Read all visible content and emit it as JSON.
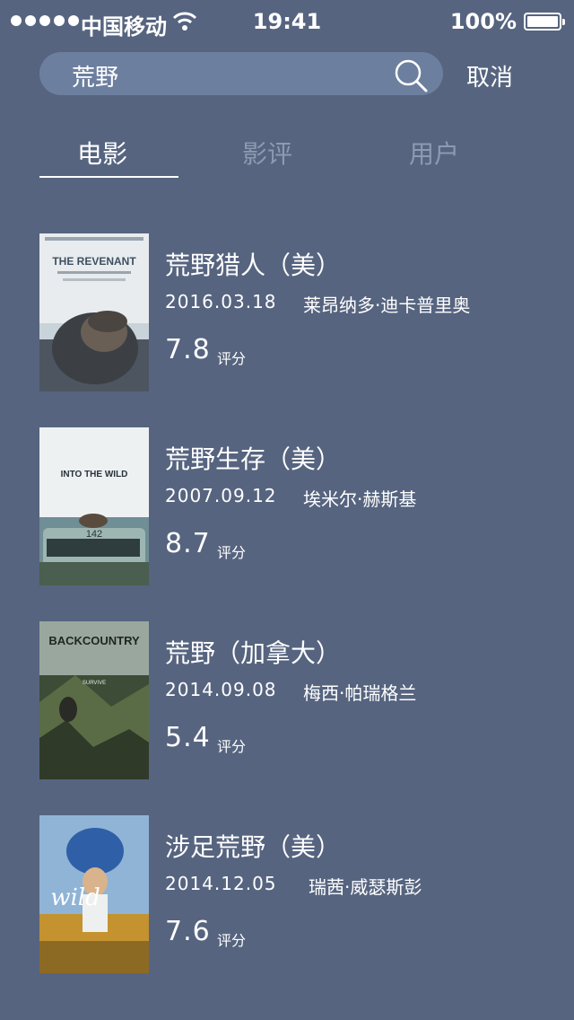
{
  "status_bar": {
    "carrier": "中国移动",
    "time": "19:41",
    "battery": "100%"
  },
  "search": {
    "query": "荒野",
    "cancel_label": "取消"
  },
  "tabs": [
    {
      "label": "电影",
      "active": true
    },
    {
      "label": "影评",
      "active": false
    },
    {
      "label": "用户",
      "active": false
    }
  ],
  "movies": [
    {
      "title": "荒野猎人（美）",
      "date": "2016.03.18",
      "director": "莱昂纳多·迪卡普里奥",
      "score": "7.8",
      "score_label": "评分",
      "poster_text": "THE REVENANT"
    },
    {
      "title": "荒野生存（美）",
      "date": "2007.09.12",
      "director": "埃米尔·赫斯基",
      "score": "8.7",
      "score_label": "评分",
      "poster_text": "INTO THE WILD",
      "poster_subtext": "142"
    },
    {
      "title": "荒野（加拿大）",
      "date": "2014.09.08",
      "director": "梅西·帕瑞格兰",
      "score": "5.4",
      "score_label": "评分",
      "poster_text": "BACKCOUNTRY",
      "poster_subtext": "SURVIVE"
    },
    {
      "title": "涉足荒野（美）",
      "date": "2014.12.05",
      "director": "瑞茜·威瑟斯彭",
      "score": "7.6",
      "score_label": "评分",
      "poster_text": "wild"
    }
  ]
}
